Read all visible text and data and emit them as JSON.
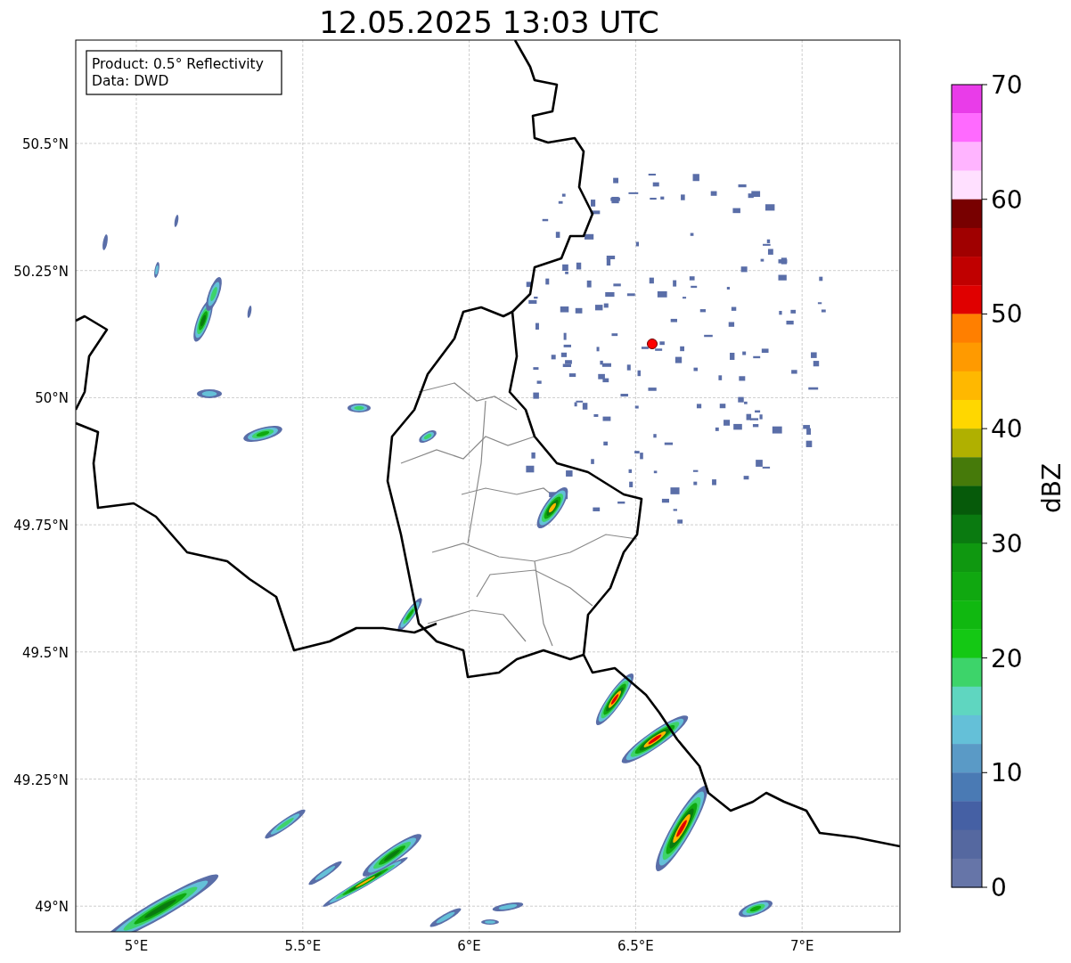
{
  "title": "12.05.2025 13:03 UTC",
  "legend": [
    "Product: 0.5° Reflectivity",
    "Data: DWD"
  ],
  "map": {
    "lat_ticks": [
      "50.5°N",
      "50.25°N",
      "50°N",
      "49.75°N",
      "49.5°N",
      "49.25°N",
      "49°N"
    ],
    "lon_ticks": [
      "5°E",
      "5.5°E",
      "6°E",
      "6.5°E",
      "7°E"
    ]
  },
  "colorbar": {
    "label": "dBZ",
    "ticks": [
      "70",
      "60",
      "50",
      "40",
      "30",
      "20",
      "10",
      "0"
    ],
    "segments": [
      {
        "color": "#e93ce9"
      },
      {
        "color": "#ff6aff"
      },
      {
        "color": "#ffb4ff"
      },
      {
        "color": "#ffe0ff"
      },
      {
        "color": "#780000"
      },
      {
        "color": "#a00000"
      },
      {
        "color": "#c00000"
      },
      {
        "color": "#e00000"
      },
      {
        "color": "#ff7f00"
      },
      {
        "color": "#ff9a00"
      },
      {
        "color": "#ffb800"
      },
      {
        "color": "#ffd700"
      },
      {
        "color": "#b0b000"
      },
      {
        "color": "#467a0a"
      },
      {
        "color": "#065a0a"
      },
      {
        "color": "#0a7a10"
      },
      {
        "color": "#0f9810"
      },
      {
        "color": "#10a810"
      },
      {
        "color": "#10b810"
      },
      {
        "color": "#14c814"
      },
      {
        "color": "#3dd46a"
      },
      {
        "color": "#5fd6c0"
      },
      {
        "color": "#64c0d8"
      },
      {
        "color": "#5a9ac6"
      },
      {
        "color": "#4a7ab4"
      },
      {
        "color": "#4560a4"
      },
      {
        "color": "#5568a0"
      },
      {
        "color": "#6675a8"
      }
    ]
  }
}
